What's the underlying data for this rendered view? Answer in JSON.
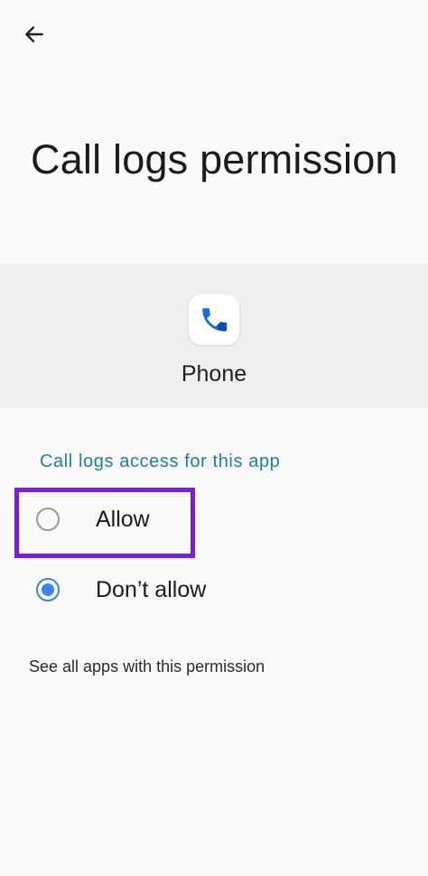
{
  "header": {
    "back_icon": "arrow-back-icon"
  },
  "page": {
    "title": "Call logs permission"
  },
  "app": {
    "name": "Phone",
    "icon": "phone-app-icon"
  },
  "permission": {
    "section_label": "Call logs access for this app",
    "options": [
      {
        "label": "Allow",
        "selected": false
      },
      {
        "label": "Don’t allow",
        "selected": true
      }
    ]
  },
  "footer": {
    "link": "See all apps with this permission"
  },
  "colors": {
    "accent": "#3b82f6",
    "section_label": "#1e7f9a",
    "highlight": "#7a1fd6",
    "banner_bg": "#efeff1"
  }
}
